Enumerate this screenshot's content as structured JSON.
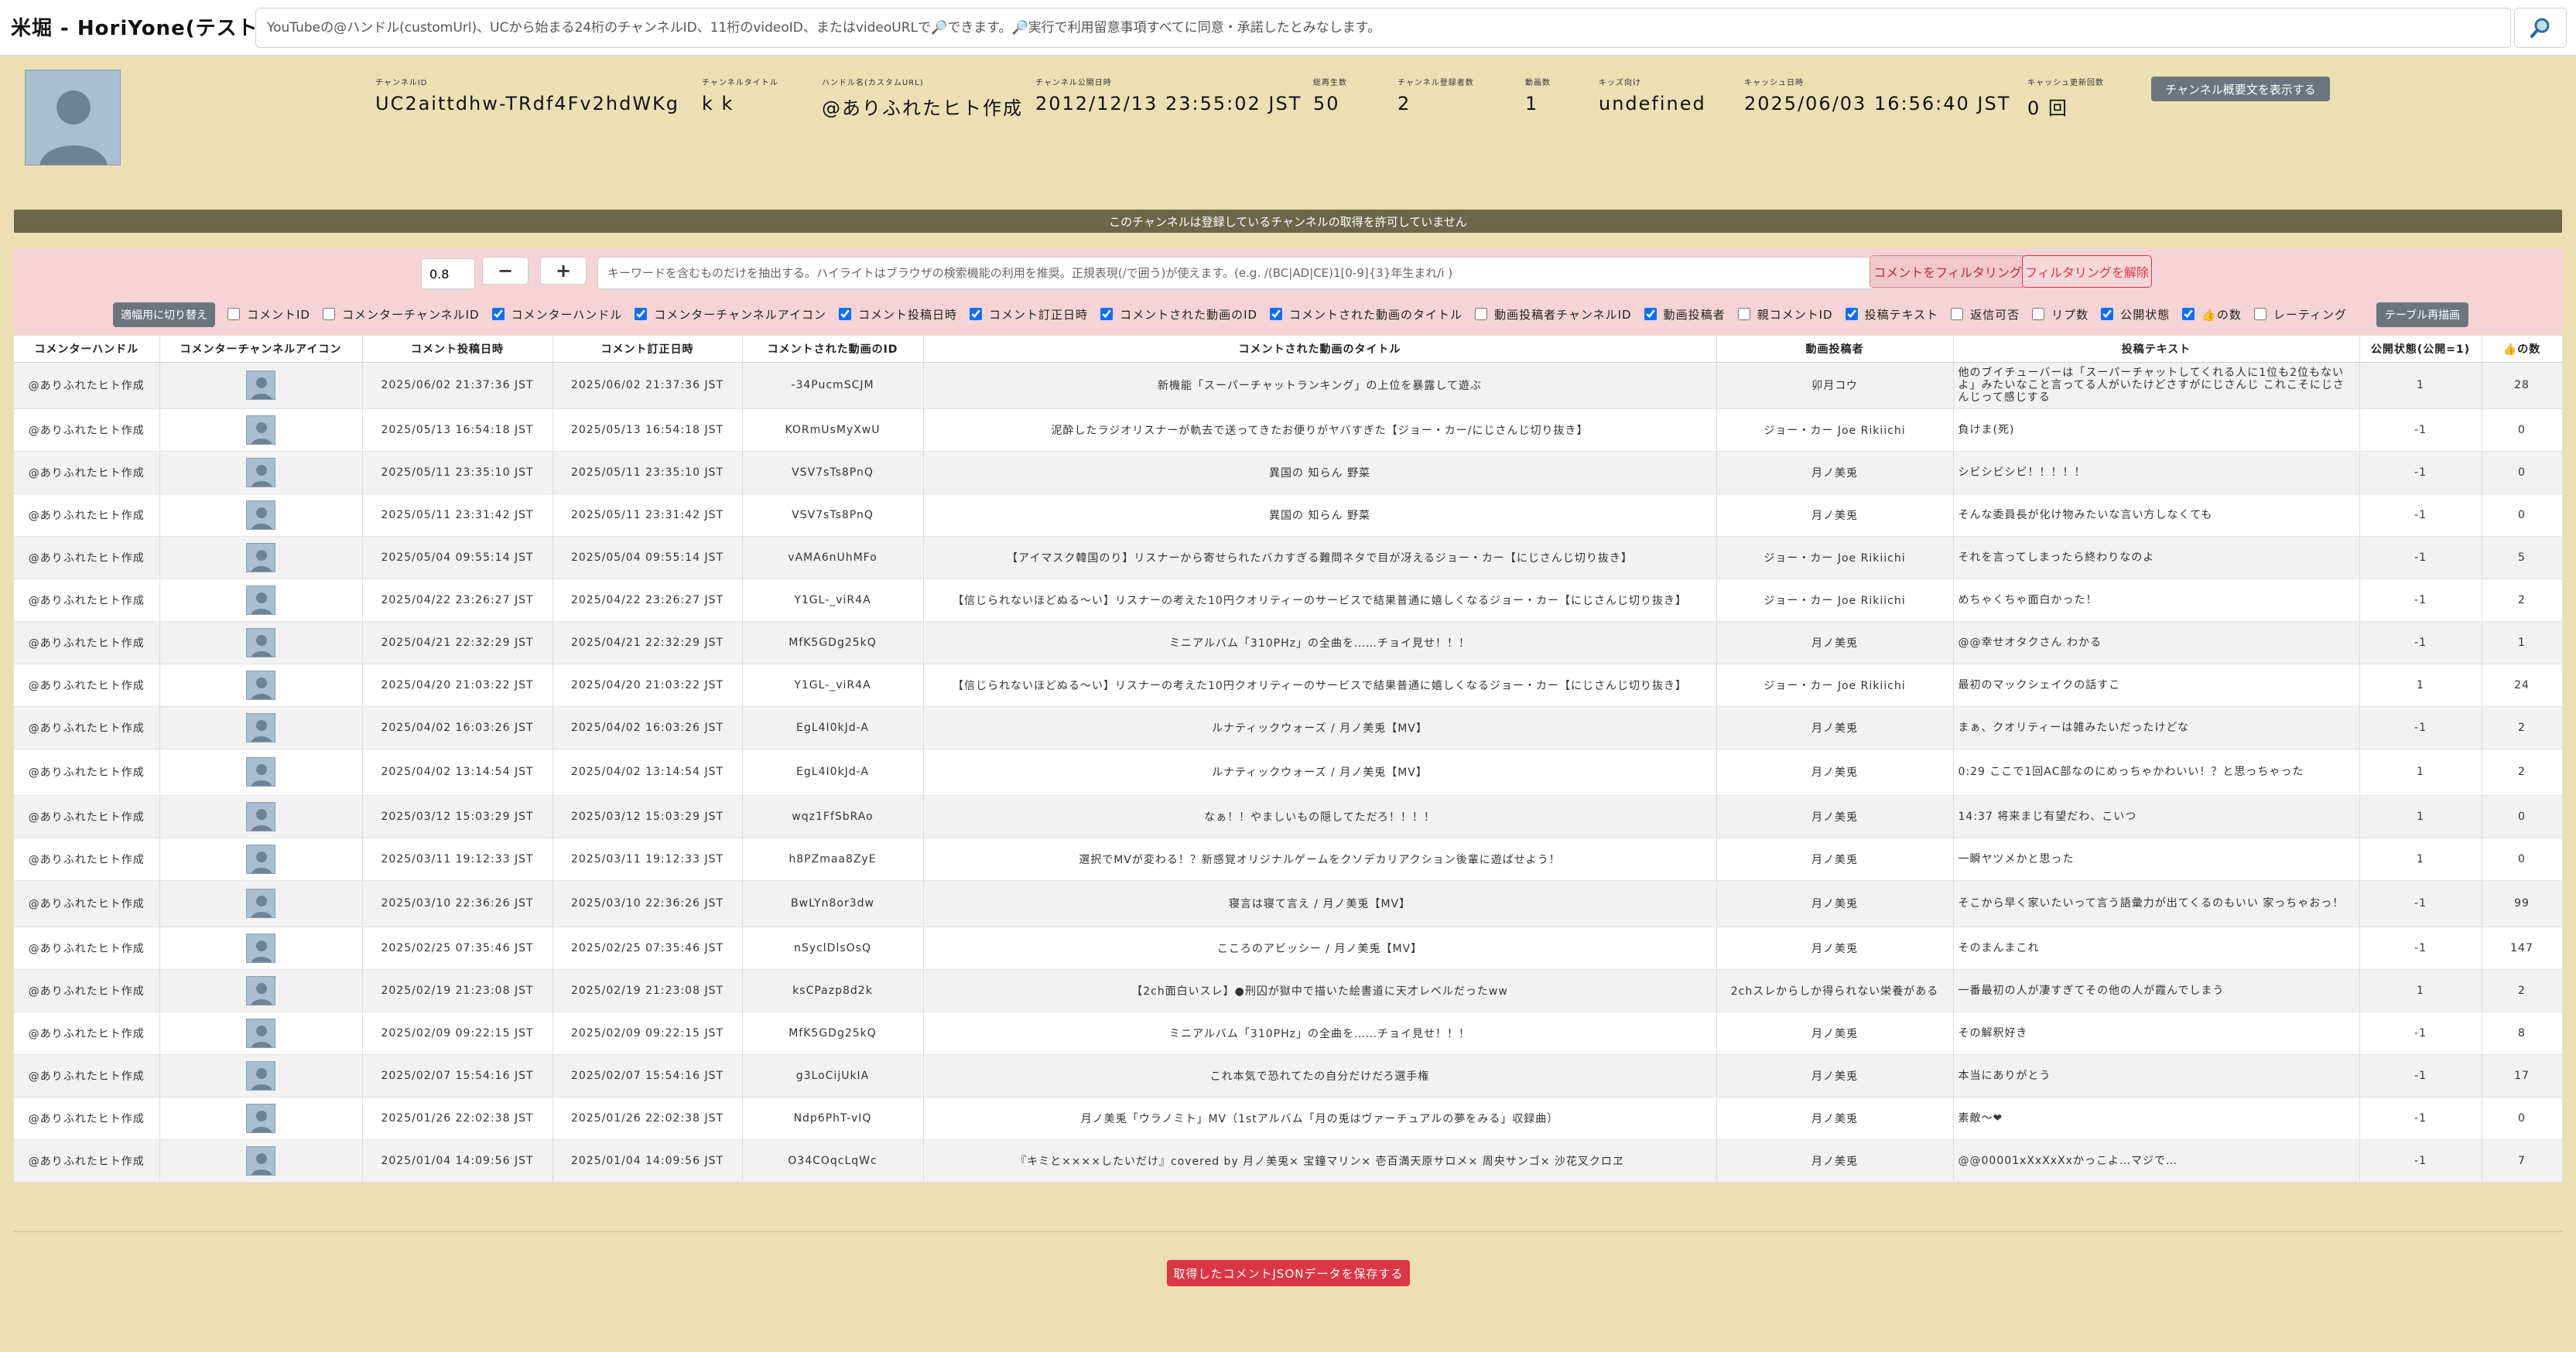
{
  "app": {
    "title": "米堀 - HoriYone(テスト中)",
    "search_placeholder": "YouTubeの@ハンドル(customUrl)、UCから始まる24桁のチャンネルID、11桁のvideoID、またはvideoURLで🔎できます。🔎実行で利用留意事項すべてに同意・承諾したとみなします。"
  },
  "channel": {
    "fields": [
      {
        "label": "チャンネルID",
        "value": "UC2aittdhw-TRdf4Fv2hdWKg"
      },
      {
        "label": "チャンネルタイトル",
        "value": "k k"
      },
      {
        "label": "ハンドル名(カスタムURL)",
        "value": "@ありふれたヒト作成"
      },
      {
        "label": "チャンネル公開日時",
        "value": "2012/12/13 23:55:02 JST"
      },
      {
        "label": "総再生数",
        "value": "50"
      },
      {
        "label": "チャンネル登録者数",
        "value": "2"
      },
      {
        "label": "動画数",
        "value": "1"
      },
      {
        "label": "キッズ向け",
        "value": "undefined"
      },
      {
        "label": "キャッシュ日時",
        "value": "2025/06/03 16:56:40 JST"
      },
      {
        "label": "キャッシュ更新回数",
        "value": "0 回"
      }
    ],
    "summary_button": "チャンネル概要文を表示する"
  },
  "banner": "このチャンネルは登録しているチャンネルの取得を許可していません",
  "filter": {
    "scale_value": "0.8",
    "minus_label": "−",
    "plus_label": "+",
    "keyword_placeholder": "キーワードを含むものだけを抽出する。ハイライトはブラウザの検索機能の利用を推奨。正規表現(/で囲う)が使えます。(e.g. /(BC|AD|CE)1[0-9]{3}年生まれ/i )",
    "filter_button": "コメントをフィルタリング",
    "clear_button": "フィルタリングを解除",
    "fit_width_button": "適幅用に切り替え",
    "redraw_button": "テーブル再描画",
    "columns": [
      {
        "label": "コメントID",
        "checked": false
      },
      {
        "label": "コメンターチャンネルID",
        "checked": false
      },
      {
        "label": "コメンターハンドル",
        "checked": true
      },
      {
        "label": "コメンターチャンネルアイコン",
        "checked": true
      },
      {
        "label": "コメント投稿日時",
        "checked": true
      },
      {
        "label": "コメント訂正日時",
        "checked": true
      },
      {
        "label": "コメントされた動画のID",
        "checked": true
      },
      {
        "label": "コメントされた動画のタイトル",
        "checked": true
      },
      {
        "label": "動画投稿者チャンネルID",
        "checked": false
      },
      {
        "label": "動画投稿者",
        "checked": true
      },
      {
        "label": "親コメントID",
        "checked": false
      },
      {
        "label": "投稿テキスト",
        "checked": true
      },
      {
        "label": "返信可否",
        "checked": false
      },
      {
        "label": "リプ数",
        "checked": false
      },
      {
        "label": "公開状態",
        "checked": true
      },
      {
        "label": "👍の数",
        "checked": true
      },
      {
        "label": "レーティング",
        "checked": false
      }
    ]
  },
  "table": {
    "headers": [
      "コメンターハンドル",
      "コメンターチャンネルアイコン",
      "コメント投稿日時",
      "コメント訂正日時",
      "コメントされた動画のID",
      "コメントされた動画のタイトル",
      "動画投稿者",
      "投稿テキスト",
      "公開状態(公開=1)",
      "👍の数"
    ],
    "rows": [
      {
        "handle": "@ありふれたヒト作成",
        "posted": "2025/06/02 21:37:36 JST",
        "edited": "2025/06/02 21:37:36 JST",
        "video_id": "-34PucmSCJM",
        "title": "新機能「スーパーチャットランキング」の上位を暴露して遊ぶ",
        "uploader": "卯月コウ",
        "text": "他のブイチューバーは「スーパーチャットしてくれる人に1位も2位もないよ」みたいなこと言ってる人がいたけどさすがにじさんじ これこそにじさんじって感じする",
        "state": "1",
        "likes": "28"
      },
      {
        "handle": "@ありふれたヒト作成",
        "posted": "2025/05/13 16:54:18 JST",
        "edited": "2025/05/13 16:54:18 JST",
        "video_id": "KORmUsMyXwU",
        "title": "泥酔したラジオリスナーが軌去で送ってきたお便りがヤバすぎた【ジョー・カー/にじさんじ切り抜き】",
        "uploader": "ジョー・カー Joe Rikiichi",
        "text": "負けま(死)",
        "state": "-1",
        "likes": "0"
      },
      {
        "handle": "@ありふれたヒト作成",
        "posted": "2025/05/11 23:35:10 JST",
        "edited": "2025/05/11 23:35:10 JST",
        "video_id": "VSV7sTs8PnQ",
        "title": "異国の 知らん 野菜",
        "uploader": "月ノ美兎",
        "text": "シビシビシビ！！！！！",
        "state": "-1",
        "likes": "0"
      },
      {
        "handle": "@ありふれたヒト作成",
        "posted": "2025/05/11 23:31:42 JST",
        "edited": "2025/05/11 23:31:42 JST",
        "video_id": "VSV7sTs8PnQ",
        "title": "異国の 知らん 野菜",
        "uploader": "月ノ美兎",
        "text": "そんな委員長が化け物みたいな言い方しなくても",
        "state": "-1",
        "likes": "0"
      },
      {
        "handle": "@ありふれたヒト作成",
        "posted": "2025/05/04 09:55:14 JST",
        "edited": "2025/05/04 09:55:14 JST",
        "video_id": "vAMA6nUhMFo",
        "title": "【アイマスク韓国のり】リスナーから寄せられたバカすぎる難問ネタで目が冴えるジョー・カー【にじさんじ切り抜き】",
        "uploader": "ジョー・カー Joe Rikiichi",
        "text": "それを言ってしまったら終わりなのよ",
        "state": "-1",
        "likes": "5"
      },
      {
        "handle": "@ありふれたヒト作成",
        "posted": "2025/04/22 23:26:27 JST",
        "edited": "2025/04/22 23:26:27 JST",
        "video_id": "Y1GL-_viR4A",
        "title": "【信じられないほどぬる〜い】リスナーの考えた10円クオリティーのサービスで結果普通に嬉しくなるジョー・カー【にじさんじ切り抜き】",
        "uploader": "ジョー・カー Joe Rikiichi",
        "text": "めちゃくちゃ面白かった！",
        "state": "-1",
        "likes": "2"
      },
      {
        "handle": "@ありふれたヒト作成",
        "posted": "2025/04/21 22:32:29 JST",
        "edited": "2025/04/21 22:32:29 JST",
        "video_id": "MfK5GDg25kQ",
        "title": "ミニアルバム「310PHz」の全曲を……チョイ見せ！！！",
        "uploader": "月ノ美兎",
        "text": "@@幸せオタクさん わかる",
        "state": "-1",
        "likes": "1"
      },
      {
        "handle": "@ありふれたヒト作成",
        "posted": "2025/04/20 21:03:22 JST",
        "edited": "2025/04/20 21:03:22 JST",
        "video_id": "Y1GL-_viR4A",
        "title": "【信じられないほどぬる〜い】リスナーの考えた10円クオリティーのサービスで結果普通に嬉しくなるジョー・カー【にじさんじ切り抜き】",
        "uploader": "ジョー・カー Joe Rikiichi",
        "text": "最初のマックシェイクの話すこ",
        "state": "1",
        "likes": "24"
      },
      {
        "handle": "@ありふれたヒト作成",
        "posted": "2025/04/02 16:03:26 JST",
        "edited": "2025/04/02 16:03:26 JST",
        "video_id": "EgL4I0kJd-A",
        "title": "ルナティックウォーズ / 月ノ美兎【MV】",
        "uploader": "月ノ美兎",
        "text": "まぁ、クオリティーは雑みたいだったけどな",
        "state": "-1",
        "likes": "2"
      },
      {
        "handle": "@ありふれたヒト作成",
        "posted": "2025/04/02 13:14:54 JST",
        "edited": "2025/04/02 13:14:54 JST",
        "video_id": "EgL4I0kJd-A",
        "title": "ルナティックウォーズ / 月ノ美兎【MV】",
        "uploader": "月ノ美兎",
        "text": "0:29 ここで1回AC部なのにめっちゃかわいい！？と思っちゃった",
        "state": "1",
        "likes": "2"
      },
      {
        "handle": "@ありふれたヒト作成",
        "posted": "2025/03/12 15:03:29 JST",
        "edited": "2025/03/12 15:03:29 JST",
        "video_id": "wqz1FfSbRAo",
        "title": "なぁ！！やましいもの隠してただろ！！！！",
        "uploader": "月ノ美兎",
        "text": "14:37 将来まじ有望だわ、こいつ",
        "state": "1",
        "likes": "0"
      },
      {
        "handle": "@ありふれたヒト作成",
        "posted": "2025/03/11 19:12:33 JST",
        "edited": "2025/03/11 19:12:33 JST",
        "video_id": "h8PZmaa8ZyE",
        "title": "選択でMVが変わる！？新感覚オリジナルゲームをクソデカリアクション後輩に遊ばせよう！",
        "uploader": "月ノ美兎",
        "text": "一瞬ヤツメかと思った",
        "state": "1",
        "likes": "0"
      },
      {
        "handle": "@ありふれたヒト作成",
        "posted": "2025/03/10 22:36:26 JST",
        "edited": "2025/03/10 22:36:26 JST",
        "video_id": "BwLYn8or3dw",
        "title": "寝言は寝て言え / 月ノ美兎【MV】",
        "uploader": "月ノ美兎",
        "text": "そこから早く家いたいって言う語彙力が出てくるのもいい 家っちゃおっ！",
        "state": "-1",
        "likes": "99"
      },
      {
        "handle": "@ありふれたヒト作成",
        "posted": "2025/02/25 07:35:46 JST",
        "edited": "2025/02/25 07:35:46 JST",
        "video_id": "nSyclDlsOsQ",
        "title": "こころのアビッシー / 月ノ美兎【MV】",
        "uploader": "月ノ美兎",
        "text": "そのまんまこれ",
        "state": "-1",
        "likes": "147"
      },
      {
        "handle": "@ありふれたヒト作成",
        "posted": "2025/02/19 21:23:08 JST",
        "edited": "2025/02/19 21:23:08 JST",
        "video_id": "ksCPazp8d2k",
        "title": "【2ch面白いスレ】●刑囚が獄中で描いた絵書道に天才レベルだったww",
        "uploader": "2chスレからしか得られない栄養がある",
        "text": "一番最初の人が凄すぎてその他の人が霞んでしまう",
        "state": "1",
        "likes": "2"
      },
      {
        "handle": "@ありふれたヒト作成",
        "posted": "2025/02/09 09:22:15 JST",
        "edited": "2025/02/09 09:22:15 JST",
        "video_id": "MfK5GDg25kQ",
        "title": "ミニアルバム「310PHz」の全曲を……チョイ見せ！！！",
        "uploader": "月ノ美兎",
        "text": "その解釈好き",
        "state": "-1",
        "likes": "8"
      },
      {
        "handle": "@ありふれたヒト作成",
        "posted": "2025/02/07 15:54:16 JST",
        "edited": "2025/02/07 15:54:16 JST",
        "video_id": "g3LoCijUkIA",
        "title": "これ本気で恐れてたの自分だけだろ選手権",
        "uploader": "月ノ美兎",
        "text": "本当にありがとう",
        "state": "-1",
        "likes": "17"
      },
      {
        "handle": "@ありふれたヒト作成",
        "posted": "2025/01/26 22:02:38 JST",
        "edited": "2025/01/26 22:02:38 JST",
        "video_id": "Ndp6PhT-vIQ",
        "title": "月ノ美兎「ウラノミト」MV（1stアルバム「月の兎はヴァーチュアルの夢をみる」収録曲）",
        "uploader": "月ノ美兎",
        "text": "素敵〜❤",
        "state": "-1",
        "likes": "0"
      },
      {
        "handle": "@ありふれたヒト作成",
        "posted": "2025/01/04 14:09:56 JST",
        "edited": "2025/01/04 14:09:56 JST",
        "video_id": "O34COqcLqWc",
        "title": "『キミと××××したいだけ』covered by 月ノ美兎× 宝鐘マリン× 壱百満天原サロメ× 周央サンゴ× 沙花叉クロヱ",
        "uploader": "月ノ美兎",
        "text": "@@00001xXxXxXxかっこよ…マジで…",
        "state": "-1",
        "likes": "7"
      }
    ]
  },
  "save_button": "取得したコメントJSONデータを保存する"
}
